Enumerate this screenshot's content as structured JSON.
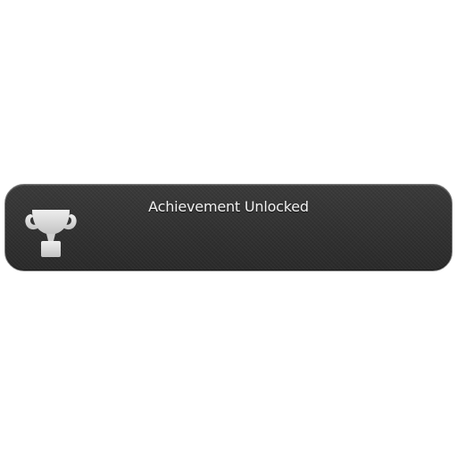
{
  "notification": {
    "title": "Achievement Unlocked",
    "icon": "trophy-icon"
  },
  "colors": {
    "panel_background": "#2f2f2f",
    "panel_border": "#7a7a7a",
    "title_text": "#f2f2f2",
    "icon_fill": "#d6d6d6"
  }
}
